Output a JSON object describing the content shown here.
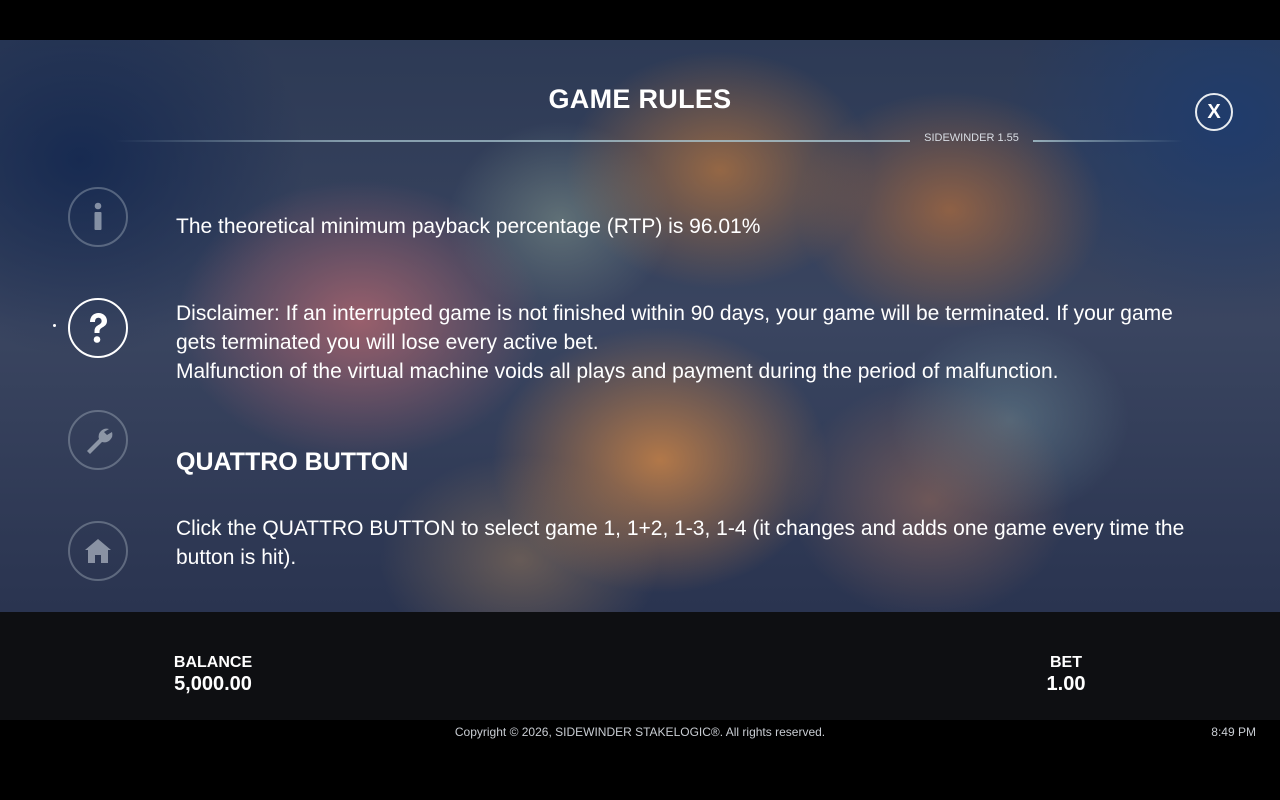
{
  "header": {
    "title": "GAME RULES",
    "version": "SIDEWINDER 1.55",
    "close_label": "X"
  },
  "sidebar": {
    "items": [
      {
        "name": "info",
        "icon": "info-icon"
      },
      {
        "name": "help",
        "icon": "question-icon",
        "active": true
      },
      {
        "name": "settings",
        "icon": "wrench-icon"
      },
      {
        "name": "home",
        "icon": "home-icon"
      }
    ]
  },
  "content": {
    "rtp_text": "The theoretical minimum payback percentage (RTP) is 96.01%",
    "disclaimer_line1": "Disclaimer: If an interrupted game is not finished within 90 days, your game will be terminated. If your game gets terminated you will lose every active bet.",
    "disclaimer_line2": "Malfunction of the virtual machine voids all plays and payment during the period of malfunction.",
    "quattro_heading": "QUATTRO BUTTON",
    "quattro_text": "Click the QUATTRO BUTTON to select game 1, 1+2, 1-3, 1-4 (it changes and adds one game every time the button is hit)."
  },
  "stats": {
    "balance_label": "BALANCE",
    "balance_value": "5,000.00",
    "bet_label": "BET",
    "bet_value": "1.00"
  },
  "footer": {
    "copyright": "Copyright © 2026, SIDEWINDER STAKELOGIC®. All rights reserved.",
    "time": "8:49 PM"
  },
  "colors": {
    "accent_line": "#aac8d2",
    "text": "#ffffff",
    "panel": "#0e0f12"
  }
}
